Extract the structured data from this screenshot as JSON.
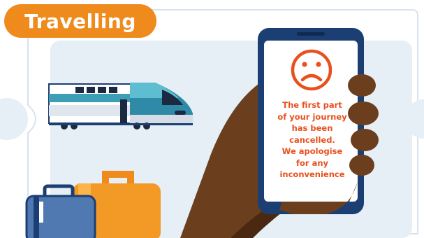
{
  "badge": {
    "title": "Travelling"
  },
  "phone": {
    "icon": "sad-face-icon",
    "message_lines": [
      "The first part",
      "of your journey",
      "has been",
      "cancelled.",
      "We apologise",
      "for any",
      "inconvenience"
    ]
  },
  "illustration": {
    "items": [
      "train-icon",
      "hand-holding-phone",
      "blue-suitcase-icon",
      "orange-suitcase-icon"
    ]
  },
  "colors": {
    "accent_orange": "#ef8a1c",
    "message_red": "#e8501e",
    "phone_frame": "#1b3f73",
    "panel_bg": "#e6eef6",
    "skin": "#6b3f1d"
  }
}
